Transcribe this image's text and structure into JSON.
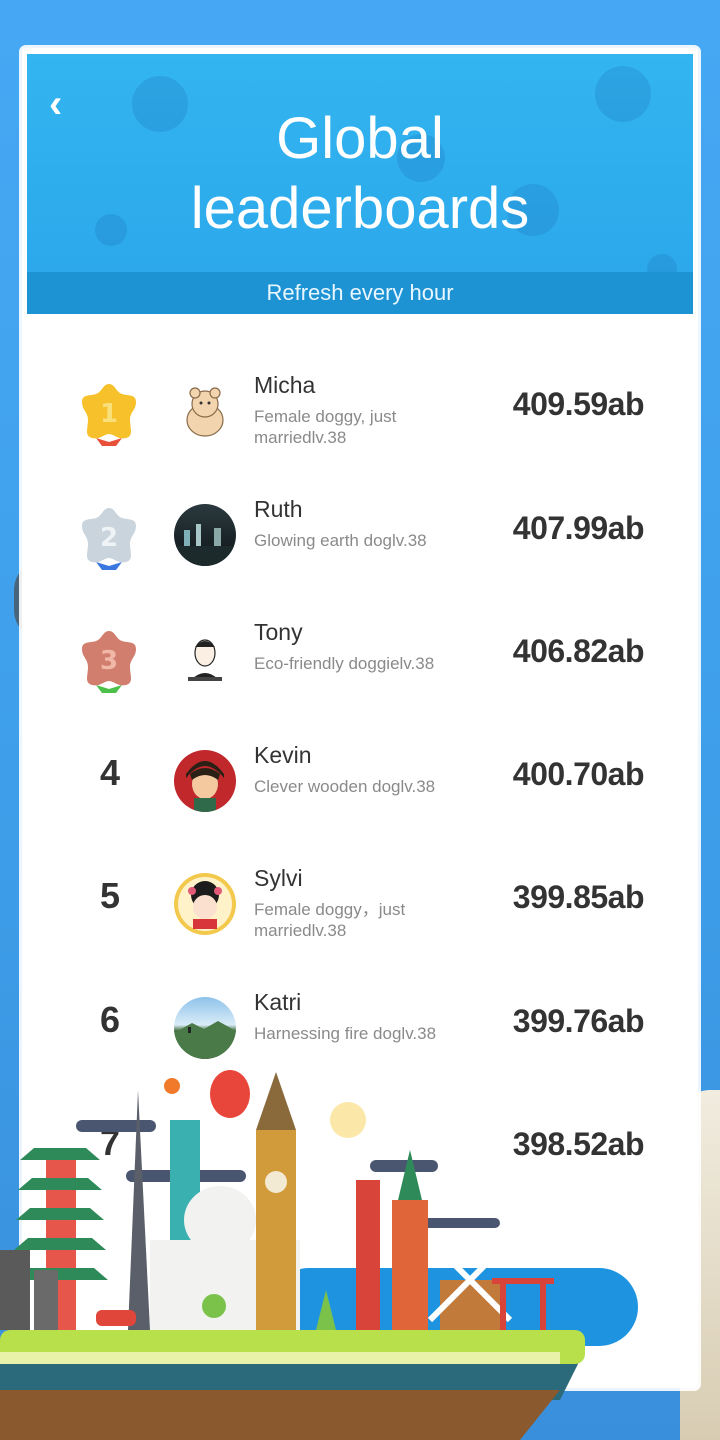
{
  "header": {
    "title_line1": "Global",
    "title_line2": "leaderboards",
    "back_glyph": "‹",
    "subtitle": "Refresh every hour"
  },
  "colors": {
    "header_top": "#33b5f0",
    "subbar": "#1e93d3",
    "gold": "#f6c12a",
    "silver": "#c9d4dc",
    "bronze": "#d27e6e"
  },
  "leaderboard": [
    {
      "rank": "1",
      "badge": "gold-star-badge",
      "name": "Micha",
      "desc": "Female doggy, just marriedlv.38",
      "score": "409.59ab",
      "avatar": "bear-avatar"
    },
    {
      "rank": "2",
      "badge": "silver-star-badge",
      "name": "Ruth",
      "desc": "Glowing earth doglv.38",
      "score": "407.99ab",
      "avatar": "night-city-avatar"
    },
    {
      "rank": "3",
      "badge": "bronze-star-badge",
      "name": "Tony",
      "desc": "Eco-friendly doggielv.38",
      "score": "406.82ab",
      "avatar": "sketch-man-avatar"
    },
    {
      "rank": "4",
      "badge": "",
      "name": "Kevin",
      "desc": "Clever wooden doglv.38",
      "score": "400.70ab",
      "avatar": "cartoon-boy-avatar"
    },
    {
      "rank": "5",
      "badge": "",
      "name": "Sylvi",
      "desc": "Female doggy，just marriedlv.38",
      "score": "399.85ab",
      "avatar": "cartoon-girl-avatar"
    },
    {
      "rank": "6",
      "badge": "",
      "name": "Katri",
      "desc": "Harnessing fire doglv.38",
      "score": "399.76ab",
      "avatar": "landscape-avatar"
    },
    {
      "rank": "7",
      "badge": "",
      "name": "",
      "desc": "",
      "score": "398.52ab",
      "avatar": "partial-avatar"
    }
  ],
  "bottom_button": {
    "icon": "landmarks-illustration"
  }
}
